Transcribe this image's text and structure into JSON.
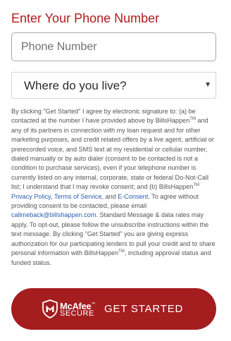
{
  "form": {
    "title": "Enter Your Phone Number",
    "phone_placeholder": "Phone Number",
    "state_select": {
      "selected": "Where do you live?"
    },
    "disclaimer": {
      "p1": "By clicking \"Get Started\" I agree by electronic signature to: (a) be contacted at the number I have provided above by BillsHappen",
      "tm1": "TM",
      "p2": " and any of its partners in connection with my loan request and for other marketing purposes, and credit related offers by a live agent, artificial or prerecorded voice, and SMS text at my residential or cellular number, dialed manually or by auto dialer (consent to be contacted is not a condition to purchase services), even if your telephone number is currently listed on any internal, corporate, state or federal Do-Not-Call list; I understand that I may revoke consent; and (b) BillsHappen",
      "tm2": "TM",
      "p3": " ",
      "privacy_link": "Privacy Policy",
      "p4": ", ",
      "terms_link": "Terms of Service",
      "p5": ", and ",
      "econsent_link": "E-Consent",
      "p6": ". To agree without providing consent to be contacted, please email ",
      "email_link": "callmeback@billshappen.com",
      "p7": ". Standard Message & data rates may apply. To opt-out, please follow the unsubscribe instructions within the text message. By clicking \"Get Started\" you are giving express authorization for our participating lenders to pull your credit and to share personal information with BillsHappen",
      "tm3": "TM",
      "p8": ", including approval status and funded status."
    },
    "cta": {
      "badge_brand": "McAfee",
      "badge_tm": "™",
      "badge_secure": "SECURE",
      "label": "GET STARTED"
    }
  },
  "colors": {
    "accent": "#b01c1c",
    "button": "#a41d1f",
    "link": "#2a5db0"
  },
  "icons": {
    "badge": "mcafee-shield-icon",
    "select": "caret-down-icon"
  }
}
